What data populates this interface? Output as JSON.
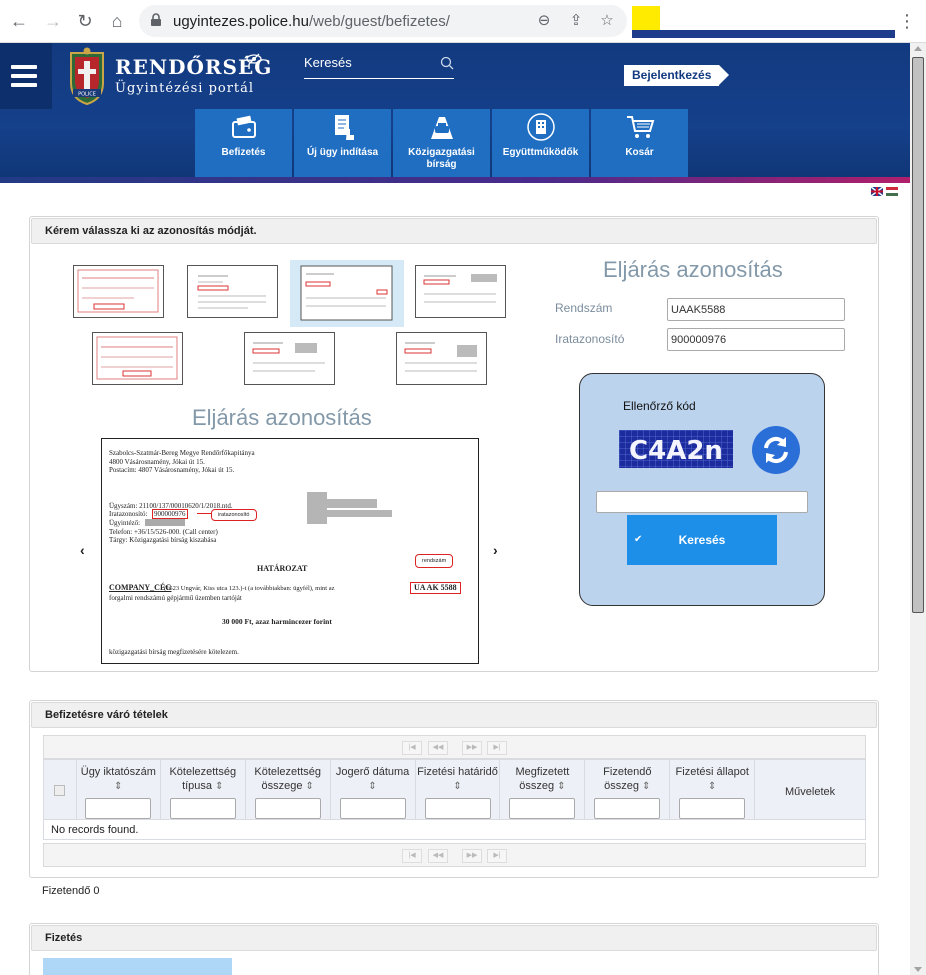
{
  "browser": {
    "url_host": "ugyintezes.police.hu",
    "url_path": "/web/guest/befizetes/"
  },
  "header": {
    "brand_title": "RENDŐRSÉG",
    "brand_subtitle": "Ügyintézési portál",
    "search_placeholder": "Keresés",
    "login_label": "Bejelentkezés",
    "logo_text": "POLICE",
    "tiles": [
      {
        "label": "Befizetés",
        "icon": "wallet-card-icon"
      },
      {
        "label": "Új ügy indítása",
        "icon": "document-touch-icon"
      },
      {
        "label": "Közigazgatási bírság",
        "icon": "car-road-icon"
      },
      {
        "label": "Együttműködők",
        "icon": "building-icon"
      },
      {
        "label": "Kosár",
        "icon": "cart-icon"
      }
    ],
    "tile_color": "#1f6ec2",
    "header_color": "#15408a"
  },
  "identify": {
    "panel_title": "Kérem válassza ki az azonosítás módját.",
    "form_heading": "Eljárás azonosítás",
    "plate_label": "Rendszám",
    "plate_value": "UAAK5588",
    "docid_label": "Iratazonosító",
    "docid_value": "900000976",
    "captcha_label": "Ellenőrző kód",
    "captcha_text": "C4A2n",
    "search_button": "Keresés",
    "example_heading": "Eljárás azonosítás"
  },
  "example_doc": {
    "authority": "Szabolcs-Szatmár-Bereg Megye Rendőrfőkapitánya",
    "address": "4800 Vásárosnamény, Jókai út 15.",
    "postal": "Postacím: 4807 Vásárosnamény, Jókai út 15.",
    "case_no": "Ügyszám: 21100/137/00010620/1/2018.ntd.",
    "doc_id_label": "Iratazonosító:",
    "doc_id": "900000976",
    "doc_id_callout": "iratazonosító",
    "handler": "Ügyintéző:",
    "phone": "Telefon: +36/15/526-000. (Call center)",
    "subject": "Tárgy: Közigazgatási bírság kiszabása",
    "decision": "HATÁROZAT",
    "plate_callout": "rendszám",
    "company": "COMPANY_CÉG",
    "company_rest": "(1523 Ungvár, Kiss utca 123.)-t (a továbbiakban: ügyfél), mint az",
    "plate": "UA AK 5588",
    "line3": "forgalmi rendszámú gépjármű üzemben tartóját",
    "amount": "30 000 Ft, azaz harmincezer forint",
    "footer": "közigazgatási bírság megfizetésére kötelezem."
  },
  "pending": {
    "panel_title": "Befizetésre váró tételek",
    "columns": [
      "Ügy iktatószám",
      "Kötelezettség típusa",
      "Kötelezettség összege",
      "Jogerő dátuma",
      "Fizetési határidő",
      "Megfizetett összeg",
      "Fizetendő összeg",
      "Fizetési állapot"
    ],
    "actions_column": "Műveletek",
    "empty_message": "No records found.",
    "total_label": "Fizetendő 0"
  },
  "payment": {
    "panel_title": "Fizetés"
  }
}
